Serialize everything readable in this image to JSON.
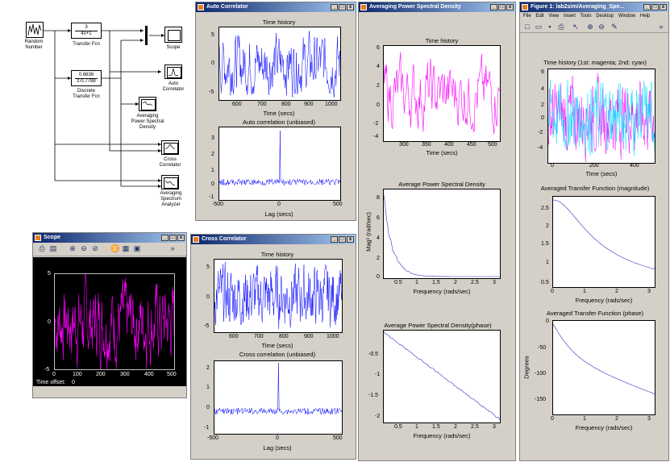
{
  "simulink": {
    "random_number": {
      "label": "Random\nNumber"
    },
    "transfer_fcn": {
      "num": "3",
      "den": "4s+1",
      "label": "Transfer Fcn"
    },
    "discrete_fcn": {
      "num": "0.6636",
      "den": "z-0.7788",
      "label": "Discrete\nTransfer Fcn"
    },
    "scope": {
      "label": "Scope"
    },
    "auto_corr": {
      "label": "Auto\nCorrelator"
    },
    "avg_psd": {
      "label": "Averaging\nPower Spectral\nDensity"
    },
    "cross_corr": {
      "label": "Cross\nCorrelator"
    },
    "avg_spec": {
      "label": "Averaging\nSpectrum\nAnalyzer"
    }
  },
  "scope_window": {
    "title": "Scope",
    "y_ticks": [
      "5",
      "0",
      "-5"
    ],
    "x_ticks": [
      "0",
      "100",
      "200",
      "300",
      "400",
      "500"
    ],
    "time_offset_label": "Time offset:",
    "time_offset_value": "0"
  },
  "auto_correlator": {
    "title": "Auto Correlator",
    "top_title": "Time history",
    "top_xlabel": "Time (secs)",
    "top_yticks": [
      "5",
      "0",
      "-5"
    ],
    "top_xticks": [
      "600",
      "700",
      "800",
      "900",
      "1000"
    ],
    "bottom_title": "Auto correlation (unbiased)",
    "bottom_xlabel": "Lag (secs)",
    "bottom_yticks": [
      "3",
      "2",
      "1",
      "0",
      "-1"
    ],
    "bottom_xticks": [
      "-500",
      "0",
      "500"
    ]
  },
  "cross_correlator": {
    "title": "Cross Correlator",
    "top_title": "Time history",
    "top_xlabel": "Time (secs)",
    "top_yticks": [
      "5",
      "0",
      "-5"
    ],
    "top_xticks": [
      "600",
      "700",
      "800",
      "900",
      "1000"
    ],
    "bottom_title": "Cross correlation (unbiased)",
    "bottom_xlabel": "Lag (secs)",
    "bottom_yticks": [
      "2",
      "1",
      "0",
      "-1"
    ],
    "bottom_xticks": [
      "-500",
      "0",
      "500"
    ]
  },
  "avg_psd_window": {
    "title": "Averaging Power Spectral Density",
    "p1_title": "Time history",
    "p1_xlabel": "Time (secs)",
    "p1_yticks": [
      "6",
      "4",
      "2",
      "0",
      "-2",
      "-4"
    ],
    "p1_xticks": [
      "300",
      "350",
      "400",
      "450",
      "500"
    ],
    "p2_title": "Average Power Spectral Density",
    "p2_ylabel": "Mag² (rad/sec)",
    "p2_xlabel": "Frequency (rads/sec)",
    "p2_yticks": [
      "8",
      "6",
      "4",
      "2",
      "0"
    ],
    "p2_xticks": [
      "0.5",
      "1",
      "1.5",
      "2",
      "2.5",
      "3"
    ],
    "p3_title": "Average Power Spectral Density(phase)",
    "p3_xlabel": "Frequency (rads/sec)",
    "p3_yticks": [
      "-0.5",
      "-1",
      "-1.5",
      "-2"
    ],
    "p3_xticks": [
      "0.5",
      "1",
      "1.5",
      "2",
      "2.5",
      "3"
    ]
  },
  "figure1": {
    "title": "Figure 1: lab2sim/Averaging_Spe...",
    "menu": [
      "File",
      "Edit",
      "View",
      "Insert",
      "Tools",
      "Desktop",
      "Window",
      "Help"
    ],
    "p1_title": "Time history (1st: magenta; 2nd: cyan)",
    "p1_xlabel": "Time (secs)",
    "p1_yticks": [
      "6",
      "4",
      "2",
      "0",
      "-2",
      "-4"
    ],
    "p1_xticks": [
      "0",
      "200",
      "400"
    ],
    "p2_title": "Averaged Transfer Function (magnitude)",
    "p2_xlabel": "Frequency (rads/sec)",
    "p2_yticks": [
      "2.5",
      "2",
      "1.5",
      "1",
      "0.5"
    ],
    "p2_xticks": [
      "0",
      "1",
      "2",
      "3"
    ],
    "p3_title": "Averaged Transfer Function (phase)",
    "p3_ylabel": "Degrees",
    "p3_xlabel": "Frequency (rads/sec)",
    "p3_yticks": [
      "0",
      "-50",
      "-100",
      "-150"
    ],
    "p3_xticks": [
      "0",
      "1",
      "2",
      "3"
    ]
  },
  "colors": {
    "blue_trace": "#0000ff",
    "magenta_trace": "#ff00ff",
    "cyan_trace": "#00e0ff",
    "line_trace": "#3030c0",
    "titlebar": "#0a246a"
  },
  "icons": [
    "window-minimize-icon",
    "window-maximize-icon",
    "window-close-icon",
    "print-icon",
    "zoom-in-icon",
    "zoom-out-icon",
    "binoculars-icon",
    "matlab-icon"
  ]
}
